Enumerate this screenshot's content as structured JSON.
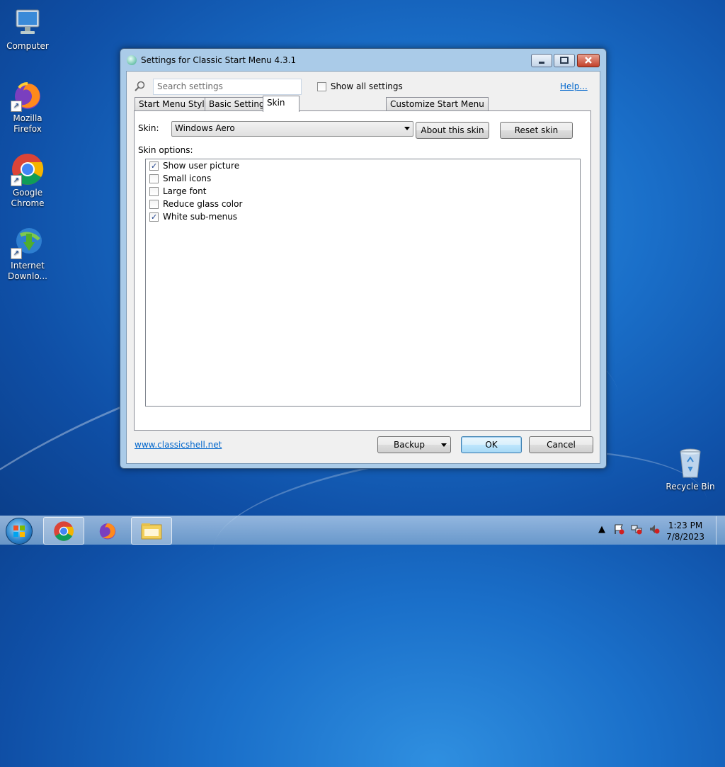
{
  "desktop": {
    "icons": [
      {
        "label": "Computer",
        "icon": "computer-icon"
      },
      {
        "label": "Mozilla Firefox",
        "line1": "Mozilla",
        "line2": "Firefox",
        "icon": "firefox-icon"
      },
      {
        "label": "Google Chrome",
        "line1": "Google",
        "line2": "Chrome",
        "icon": "chrome-icon"
      },
      {
        "label": "Internet Downlo...",
        "line1": "Internet",
        "line2": "Downlo...",
        "icon": "internet-download-manager-icon"
      },
      {
        "label": "Recycle Bin",
        "icon": "recycle-bin-icon"
      }
    ]
  },
  "window": {
    "title": "Settings for Classic Start Menu 4.3.1",
    "controls": {
      "minimize": "minimize-icon",
      "maximize": "maximize-icon",
      "close": "close-icon"
    }
  },
  "toolbar": {
    "search_placeholder": "Search settings",
    "show_all_label": "Show all settings",
    "show_all_checked": false,
    "help_link": "Help..."
  },
  "tabs": [
    {
      "label": "Start Menu Style",
      "active": false
    },
    {
      "label": "Basic Settings",
      "active": false
    },
    {
      "label": "Skin",
      "active": true
    },
    {
      "label": "Customize Start Menu",
      "active": false
    }
  ],
  "skin": {
    "label": "Skin:",
    "selected": "Windows Aero",
    "about_button": "About this skin",
    "reset_button": "Reset skin",
    "options_label": "Skin options:",
    "options": [
      {
        "label": "Show user picture",
        "checked": true
      },
      {
        "label": "Small icons",
        "checked": false
      },
      {
        "label": "Large font",
        "checked": false
      },
      {
        "label": "Reduce glass color",
        "checked": false
      },
      {
        "label": "White sub-menus",
        "checked": true
      }
    ]
  },
  "footer": {
    "website_link": "www.classicshell.net",
    "backup_button": "Backup",
    "ok_button": "OK",
    "cancel_button": "Cancel"
  },
  "taskbar": {
    "pinned": [
      "chrome-icon",
      "firefox-icon",
      "file-explorer-icon"
    ],
    "tray_icons": [
      "show-hidden-icons-icon",
      "action-center-icon",
      "network-icon",
      "volume-muted-icon"
    ],
    "time": "1:23 PM",
    "date": "7/8/2023"
  }
}
